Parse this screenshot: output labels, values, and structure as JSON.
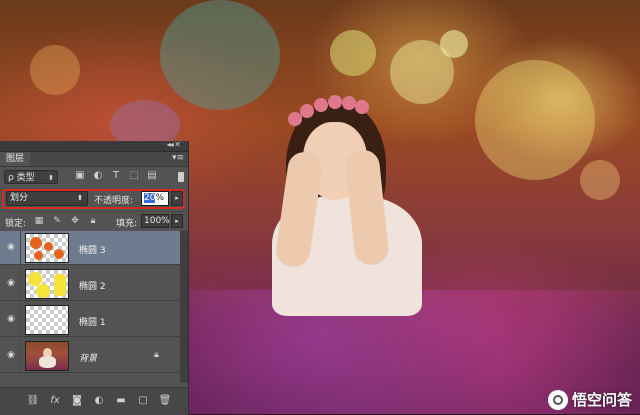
{
  "layers_panel": {
    "tab_title": "图层",
    "filter_kind": "ρ 类型",
    "blend_mode": "划分",
    "opacity_label": "不透明度:",
    "opacity_value_prefix": "20",
    "opacity_value_suffix": "%",
    "lock_label": "锁定:",
    "fill_label": "填充:",
    "fill_value": "100%",
    "layers": [
      {
        "name": "椭圆 3",
        "visible": true,
        "active": true
      },
      {
        "name": "椭圆 2",
        "visible": true,
        "active": false
      },
      {
        "name": "椭圆 1",
        "visible": true,
        "active": false
      },
      {
        "name": "背景",
        "visible": true,
        "active": false,
        "locked": true
      }
    ],
    "colors": {
      "highlight": "#d42a20",
      "active_layer": "#6f7c8f",
      "panel": "#535353"
    }
  },
  "watermark": {
    "text": "悟空问答"
  }
}
